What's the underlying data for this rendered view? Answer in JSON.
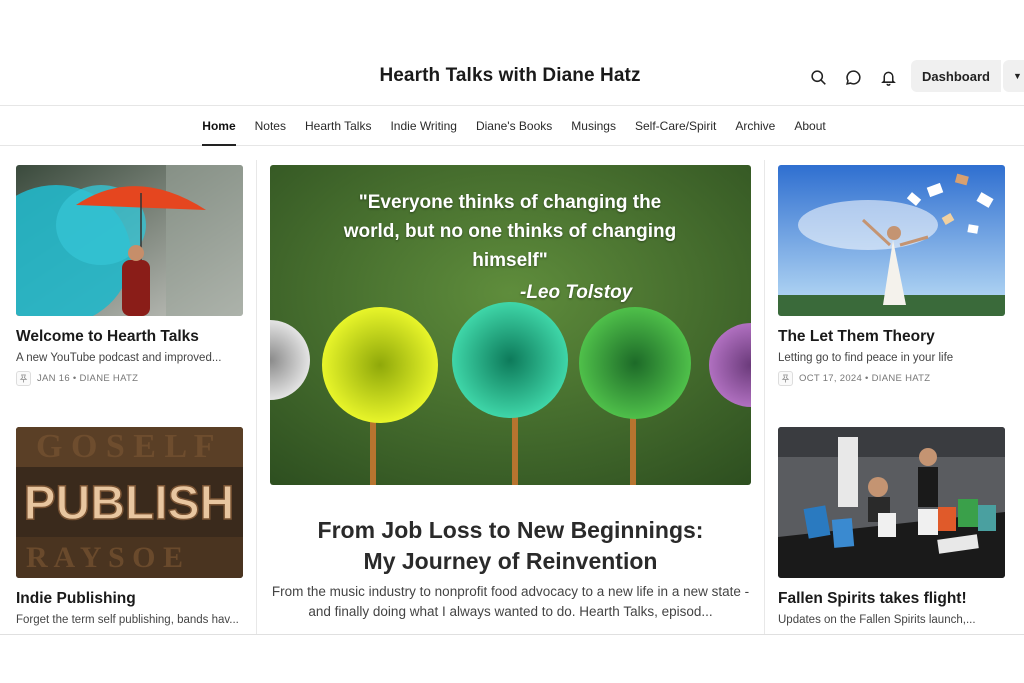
{
  "header": {
    "site_title": "Hearth Talks with Diane Hatz",
    "dashboard_label": "Dashboard",
    "icons": [
      "search-icon",
      "chat-icon",
      "bell-icon",
      "caret-down-icon"
    ]
  },
  "nav": {
    "items": [
      {
        "label": "Home",
        "active": true
      },
      {
        "label": "Notes"
      },
      {
        "label": "Hearth Talks"
      },
      {
        "label": "Indie Writing"
      },
      {
        "label": "Diane's Books"
      },
      {
        "label": "Musings"
      },
      {
        "label": "Self-Care/Spirit"
      },
      {
        "label": "Archive"
      },
      {
        "label": "About"
      }
    ]
  },
  "left_column": [
    {
      "title": "Welcome to Hearth Talks",
      "subtitle": "A new YouTube podcast and improved...",
      "meta": "JAN 16 • DIANE HATZ",
      "image": "woman-with-orange-umbrella"
    },
    {
      "title": "Indie Publishing",
      "subtitle": "Forget the term self publishing, bands hav...",
      "image": "publish-letterpress-blocks"
    }
  ],
  "featured": {
    "image_quote": "\"Everyone thinks of changing the world, but no one thinks of changing himself\"",
    "image_quote_author": "-Leo Tolstoy",
    "title_line1": "From Job Loss to New Beginnings:",
    "title_line2": "My Journey of Reinvention",
    "subtitle": "From the music industry to nonprofit food advocacy to a new life in a new state - and finally doing what I always wanted to do. Hearth Talks, episod..."
  },
  "right_column": [
    {
      "title": "The Let Them Theory",
      "subtitle": "Letting go to find peace in your life",
      "meta": "OCT 17, 2024 • DIANE HATZ",
      "image": "woman-releasing-papers-sky"
    },
    {
      "title": "Fallen Spirits takes flight!",
      "subtitle": "Updates on the Fallen Spirits launch,...",
      "image": "book-fair-table"
    }
  ],
  "colors": {
    "accent": "#222222",
    "nav_border": "#e6e6e6",
    "button_bg": "#f0f0f0"
  }
}
